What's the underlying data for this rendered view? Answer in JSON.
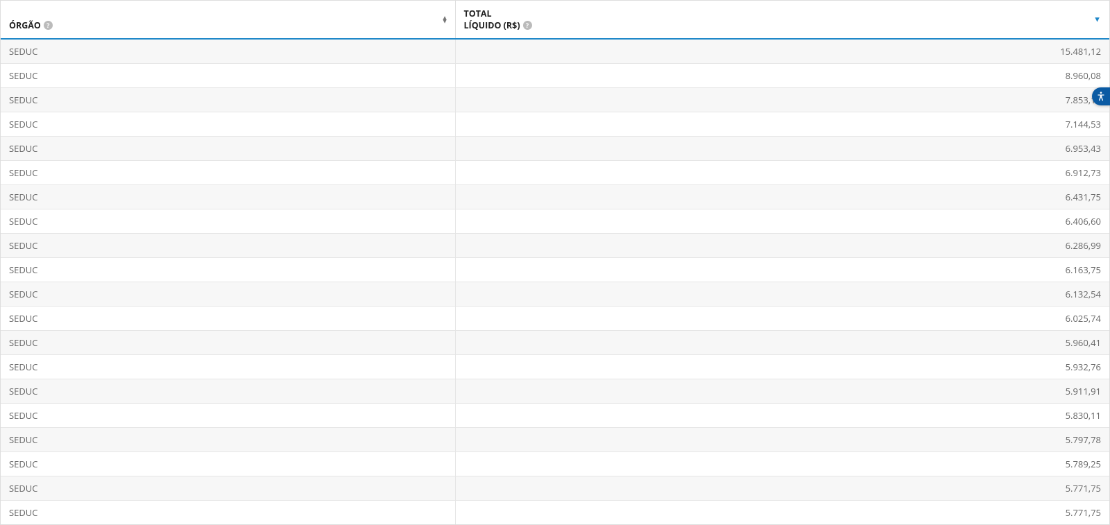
{
  "table": {
    "headers": {
      "orgao": "ÓRGÃO",
      "total_liquido_line1": "TOTAL",
      "total_liquido_line2": "LÍQUIDO (R$)"
    },
    "rows": [
      {
        "orgao": "SEDUC",
        "total": "15.481,12"
      },
      {
        "orgao": "SEDUC",
        "total": "8.960,08"
      },
      {
        "orgao": "SEDUC",
        "total": "7.853,11"
      },
      {
        "orgao": "SEDUC",
        "total": "7.144,53"
      },
      {
        "orgao": "SEDUC",
        "total": "6.953,43"
      },
      {
        "orgao": "SEDUC",
        "total": "6.912,73"
      },
      {
        "orgao": "SEDUC",
        "total": "6.431,75"
      },
      {
        "orgao": "SEDUC",
        "total": "6.406,60"
      },
      {
        "orgao": "SEDUC",
        "total": "6.286,99"
      },
      {
        "orgao": "SEDUC",
        "total": "6.163,75"
      },
      {
        "orgao": "SEDUC",
        "total": "6.132,54"
      },
      {
        "orgao": "SEDUC",
        "total": "6.025,74"
      },
      {
        "orgao": "SEDUC",
        "total": "5.960,41"
      },
      {
        "orgao": "SEDUC",
        "total": "5.932,76"
      },
      {
        "orgao": "SEDUC",
        "total": "5.911,91"
      },
      {
        "orgao": "SEDUC",
        "total": "5.830,11"
      },
      {
        "orgao": "SEDUC",
        "total": "5.797,78"
      },
      {
        "orgao": "SEDUC",
        "total": "5.789,25"
      },
      {
        "orgao": "SEDUC",
        "total": "5.771,75"
      },
      {
        "orgao": "SEDUC",
        "total": "5.771,75"
      }
    ]
  },
  "icons": {
    "help_glyph": "?",
    "sort_up_glyph": "▲",
    "sort_down_glyph": "▼"
  }
}
